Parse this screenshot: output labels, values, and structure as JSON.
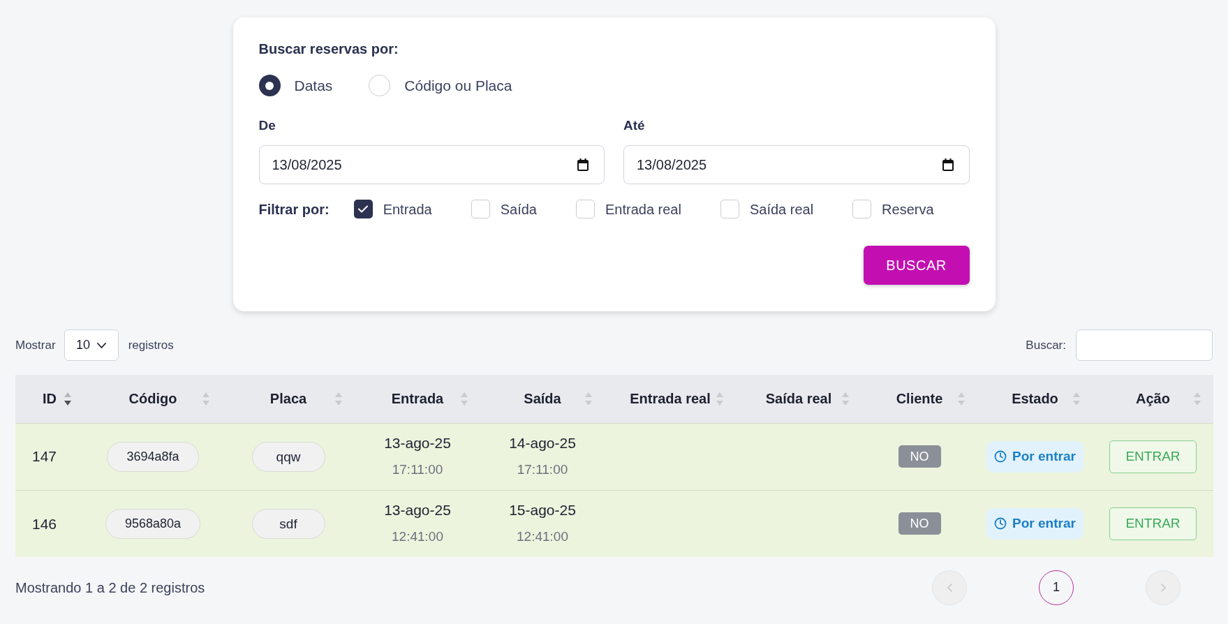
{
  "search": {
    "title": "Buscar reservas por:",
    "modes": [
      {
        "label": "Datas",
        "selected": true
      },
      {
        "label": "Código ou Placa",
        "selected": false
      }
    ],
    "dates": [
      {
        "label": "De",
        "value": "13/08/2025"
      },
      {
        "label": "Até",
        "value": "13/08/2025"
      }
    ],
    "filter": {
      "label": "Filtrar por:",
      "options": [
        {
          "label": "Entrada",
          "checked": true
        },
        {
          "label": "Saída",
          "checked": false
        },
        {
          "label": "Entrada real",
          "checked": false
        },
        {
          "label": "Saída real",
          "checked": false
        },
        {
          "label": "Reserva",
          "checked": false
        }
      ]
    },
    "button": "BUSCAR"
  },
  "controls": {
    "show_label": "Mostrar",
    "page_size": "10",
    "records_label": "registros",
    "search_label": "Buscar:"
  },
  "table": {
    "columns": [
      {
        "label": "ID",
        "sorted_descending": true
      },
      {
        "label": "Código",
        "sorted_descending": false
      },
      {
        "label": "Placa",
        "sorted_descending": false
      },
      {
        "label": "Entrada",
        "sorted_descending": false
      },
      {
        "label": "Saída",
        "sorted_descending": false
      },
      {
        "label": "Entrada real",
        "sorted_descending": false
      },
      {
        "label": "Saída real",
        "sorted_descending": false
      },
      {
        "label": "Cliente",
        "sorted_descending": false
      },
      {
        "label": "Estado",
        "sorted_descending": false
      },
      {
        "label": "Ação",
        "sorted_descending": false
      }
    ],
    "rows": [
      {
        "id": "147",
        "code": "3694a8fa",
        "plate": "qqw",
        "entrada": {
          "date": "13-ago-25",
          "time": "17:11:00"
        },
        "saida": {
          "date": "14-ago-25",
          "time": "17:11:00"
        },
        "cliente": "NO",
        "estado": "Por entrar",
        "action": "ENTRAR"
      },
      {
        "id": "146",
        "code": "9568a80a",
        "plate": "sdf",
        "entrada": {
          "date": "13-ago-25",
          "time": "12:41:00"
        },
        "saida": {
          "date": "15-ago-25",
          "time": "12:41:00"
        },
        "cliente": "NO",
        "estado": "Por entrar",
        "action": "ENTRAR"
      }
    ]
  },
  "footer": {
    "info": "Mostrando 1 a 2 de 2 registros",
    "previous": {
      "disabled": true
    },
    "pages": [
      {
        "label": "1",
        "selected": true
      }
    ],
    "next": {
      "disabled": true
    }
  }
}
